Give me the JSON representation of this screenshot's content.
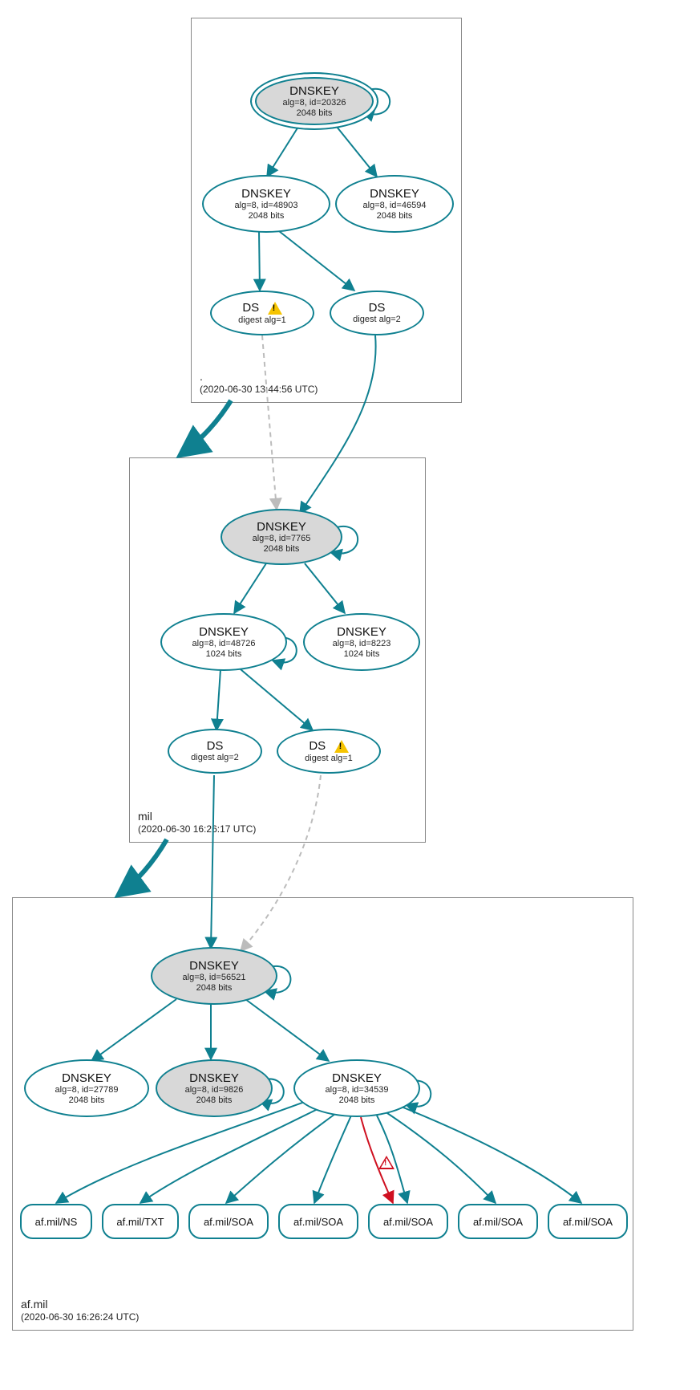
{
  "zones": [
    {
      "name": ".",
      "timestamp": "(2020-06-30 13:44:56 UTC)"
    },
    {
      "name": "mil",
      "timestamp": "(2020-06-30 16:26:17 UTC)"
    },
    {
      "name": "af.mil",
      "timestamp": "(2020-06-30 16:26:24 UTC)"
    }
  ],
  "nodes": {
    "root_ksk": {
      "title": "DNSKEY",
      "det1": "alg=8, id=20326",
      "det2": "2048 bits"
    },
    "root_zsk1": {
      "title": "DNSKEY",
      "det1": "alg=8, id=48903",
      "det2": "2048 bits"
    },
    "root_zsk2": {
      "title": "DNSKEY",
      "det1": "alg=8, id=46594",
      "det2": "2048 bits"
    },
    "root_ds1": {
      "title": "DS",
      "det1": "digest alg=1"
    },
    "root_ds2": {
      "title": "DS",
      "det1": "digest alg=2"
    },
    "mil_ksk": {
      "title": "DNSKEY",
      "det1": "alg=8, id=7765",
      "det2": "2048 bits"
    },
    "mil_zsk1": {
      "title": "DNSKEY",
      "det1": "alg=8, id=48726",
      "det2": "1024 bits"
    },
    "mil_zsk2": {
      "title": "DNSKEY",
      "det1": "alg=8, id=8223",
      "det2": "1024 bits"
    },
    "mil_ds1": {
      "title": "DS",
      "det1": "digest alg=2"
    },
    "mil_ds2": {
      "title": "DS",
      "det1": "digest alg=1"
    },
    "af_ksk": {
      "title": "DNSKEY",
      "det1": "alg=8, id=56521",
      "det2": "2048 bits"
    },
    "af_zsk1": {
      "title": "DNSKEY",
      "det1": "alg=8, id=27789",
      "det2": "2048 bits"
    },
    "af_zsk2": {
      "title": "DNSKEY",
      "det1": "alg=8, id=9826",
      "det2": "2048 bits"
    },
    "af_zsk3": {
      "title": "DNSKEY",
      "det1": "alg=8, id=34539",
      "det2": "2048 bits"
    },
    "rr1": {
      "title": "af.mil/NS"
    },
    "rr2": {
      "title": "af.mil/TXT"
    },
    "rr3": {
      "title": "af.mil/SOA"
    },
    "rr4": {
      "title": "af.mil/SOA"
    },
    "rr5": {
      "title": "af.mil/SOA"
    },
    "rr6": {
      "title": "af.mil/SOA"
    },
    "rr7": {
      "title": "af.mil/SOA"
    }
  }
}
